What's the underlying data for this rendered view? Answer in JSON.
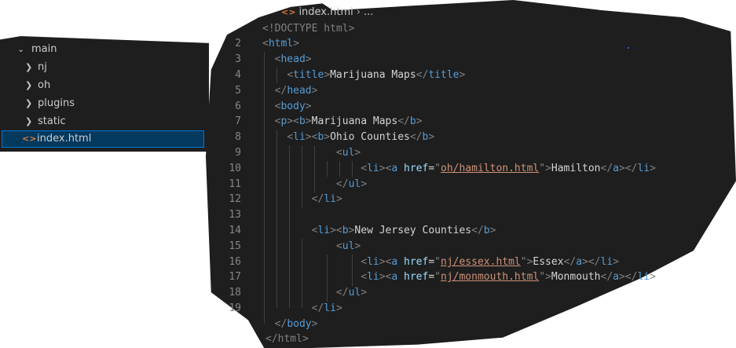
{
  "explorer": {
    "root_label": "main",
    "items": [
      {
        "label": "nj",
        "kind": "folder"
      },
      {
        "label": "oh",
        "kind": "folder"
      },
      {
        "label": "plugins",
        "kind": "folder"
      },
      {
        "label": "static",
        "kind": "folder"
      },
      {
        "label": "index.html",
        "kind": "file",
        "selected": true
      }
    ]
  },
  "tab": {
    "filename": "index.html",
    "breadcrumb_more": "..."
  },
  "editor": {
    "line_numbers": [
      "2",
      "3",
      "4",
      "5",
      "6",
      "7",
      "8",
      "9",
      "10",
      "11",
      "12",
      "13",
      "14",
      "15",
      "16",
      "17",
      "18",
      "19"
    ],
    "first_line": "<!DOCTYPE html>",
    "last_line": "</html>",
    "lines": {
      "l2": "<html>",
      "l3": "<head>",
      "l4_title": "Marijuana Maps",
      "l7_title": "Marijuana Maps",
      "l8_heading": "Ohio Counties",
      "l10_href": "oh/hamilton.html",
      "l10_text": "Hamilton",
      "l14_heading": "New Jersey Counties",
      "l16_href": "nj/essex.html",
      "l16_text": "Essex",
      "l17_href": "nj/monmouth.html",
      "l17_text": "Monmouth"
    }
  },
  "colors": {
    "background": "#1e1e1e",
    "tag": "#569cd6",
    "punct": "#808080",
    "attr": "#9cdcfe",
    "string": "#ce9178",
    "selection": "#04395e"
  }
}
